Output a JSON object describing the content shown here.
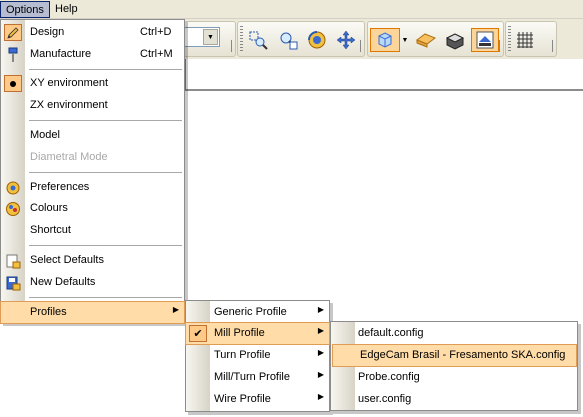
{
  "menubar": {
    "items": [
      {
        "label": "Options"
      },
      {
        "label": "Help"
      }
    ]
  },
  "toolbar": {
    "icons": [
      "zoom-window-icon",
      "zoom-select-icon",
      "rotate-view-icon",
      "pan-view-icon",
      "iso-view-icon",
      "view-dropdown-icon",
      "shaded-solid-icon",
      "shaded-box-icon",
      "display-mode-icon",
      "grid-icon"
    ]
  },
  "options_menu": {
    "items": [
      {
        "label": "Design",
        "accel": "Ctrl+D",
        "icon": "pencil-icon"
      },
      {
        "label": "Manufacture",
        "accel": "Ctrl+M",
        "icon": "drill-tool-icon"
      },
      {
        "label": "XY environment",
        "checked": true
      },
      {
        "label": "ZX environment"
      },
      {
        "label": "Model"
      },
      {
        "label": "Diametral Mode",
        "disabled": true
      },
      {
        "label": "Preferences",
        "icon": "preferences-icon"
      },
      {
        "label": "Colours",
        "icon": "colours-icon"
      },
      {
        "label": "Shortcut"
      },
      {
        "label": "Select Defaults",
        "icon": "select-defaults-icon"
      },
      {
        "label": "New Defaults",
        "icon": "new-defaults-icon"
      },
      {
        "label": "Profiles",
        "submenu": true,
        "highlighted": true
      }
    ]
  },
  "profiles_menu": {
    "items": [
      {
        "label": "Generic Profile"
      },
      {
        "label": "Mill Profile",
        "checked": true,
        "highlighted": true
      },
      {
        "label": "Turn Profile"
      },
      {
        "label": "Mill/Turn Profile"
      },
      {
        "label": "Wire Profile"
      }
    ]
  },
  "mill_profile_menu": {
    "items": [
      {
        "label": "default.config"
      },
      {
        "label": "EdgeCam Brasil - Fresamento SKA.config",
        "highlighted": true
      },
      {
        "label": "Probe.config"
      },
      {
        "label": "user.config"
      }
    ]
  },
  "colors": {
    "highlight": "#ffdca8",
    "highlight_border": "#e09b54",
    "check_fill": "#ffca88"
  }
}
